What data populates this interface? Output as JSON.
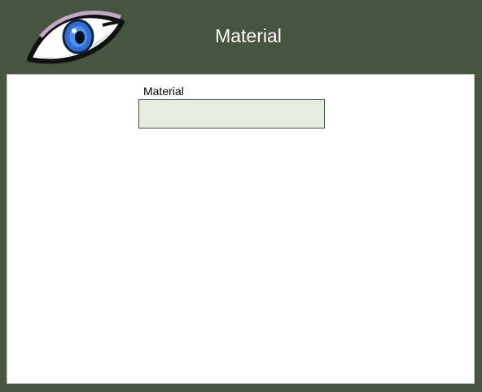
{
  "header": {
    "title": "Material",
    "logo_icon": "eye-icon"
  },
  "form": {
    "material_label": "Material",
    "material_value": "",
    "material_placeholder": ""
  },
  "colors": {
    "frame": "#475440",
    "header_text": "#ffffff",
    "panel": "#ffffff",
    "input_fill": "#e5ede2",
    "input_border": "#475440",
    "iris": "#2f6ed0"
  }
}
